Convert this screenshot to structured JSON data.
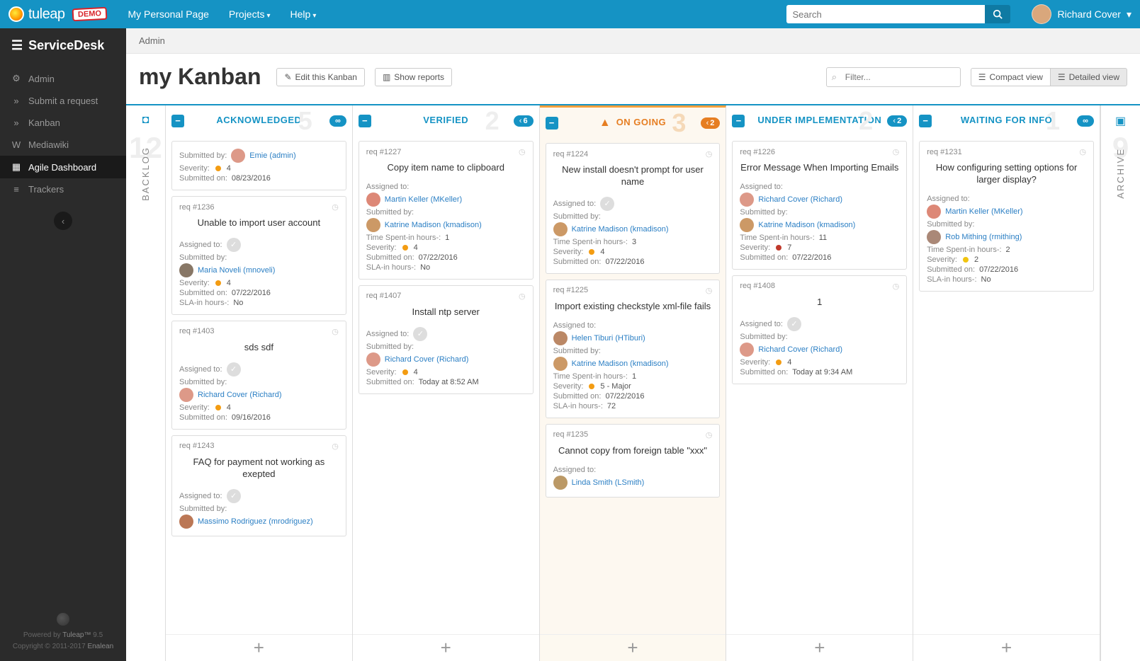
{
  "topbar": {
    "brand": "tuleap",
    "demo": "DEMO",
    "nav": {
      "personal": "My Personal Page",
      "projects": "Projects",
      "help": "Help"
    },
    "search_placeholder": "Search",
    "user_name": "Richard Cover"
  },
  "sidebar": {
    "project": "ServiceDesk",
    "items": [
      {
        "icon": "cogs",
        "label": "Admin"
      },
      {
        "icon": "chevron",
        "label": "Submit a request"
      },
      {
        "icon": "chevron",
        "label": "Kanban"
      },
      {
        "icon": "wiki",
        "label": "Mediawiki"
      },
      {
        "icon": "grid",
        "label": "Agile Dashboard"
      },
      {
        "icon": "list",
        "label": "Trackers"
      }
    ],
    "footer_powered": "Powered by ",
    "footer_brand": "Tuleap™",
    "footer_version": " 9.5",
    "footer_copyright": "Copyright © 2011-2017 ",
    "footer_company": "Enalean"
  },
  "breadcrumb": "Admin",
  "header": {
    "title": "my Kanban",
    "edit_btn": "Edit this Kanban",
    "reports_btn": "Show reports",
    "filter_placeholder": "Filter...",
    "compact": "Compact view",
    "detailed": "Detailed view"
  },
  "rails": {
    "backlog": {
      "label": "BACKLOG",
      "count": "12"
    },
    "archive": {
      "label": "ARCHIVE",
      "count": "9"
    }
  },
  "columns": [
    {
      "title": "ACKNOWLEDGED",
      "count": "5",
      "wip": "inf",
      "highlight": false
    },
    {
      "title": "VERIFIED",
      "count": "2",
      "wip": "6",
      "highlight": false
    },
    {
      "title": "ON GOING",
      "count": "3",
      "wip": "2",
      "highlight": true,
      "warn": true
    },
    {
      "title": "UNDER IMPLEMENTATION",
      "count": "2",
      "wip": "2",
      "highlight": false
    },
    {
      "title": "WAITING FOR INFO",
      "count": "1",
      "wip": "inf",
      "highlight": false
    }
  ],
  "cards": {
    "ack": [
      {
        "id": "",
        "title": "",
        "partial": true,
        "rows": [
          {
            "k": "Submitted by:",
            "avatar": "#d98",
            "link": "Emie (admin)"
          },
          {
            "k": "Severity:",
            "sev": "orange",
            "v": "4"
          },
          {
            "k": "Submitted on:",
            "v": "08/23/2016"
          }
        ]
      },
      {
        "id": "req #1236",
        "title": "Unable to import user account",
        "rows": [
          {
            "k": "Assigned to:",
            "ghost": true
          },
          {
            "k": "Submitted by:"
          },
          {
            "avatar": "#876",
            "link": "Maria Noveli (mnoveli)"
          },
          {
            "k": "Severity:",
            "sev": "orange",
            "v": "4"
          },
          {
            "k": "Submitted on:",
            "v": "07/22/2016"
          },
          {
            "k": "SLA-in hours-:",
            "v": "No"
          }
        ]
      },
      {
        "id": "req #1403",
        "title": "sds sdf",
        "rows": [
          {
            "k": "Assigned to:",
            "ghost": true
          },
          {
            "k": "Submitted by:"
          },
          {
            "avatar": "#d98",
            "link": "Richard Cover (Richard)"
          },
          {
            "k": "Severity:",
            "sev": "orange",
            "v": "4"
          },
          {
            "k": "Submitted on:",
            "v": "09/16/2016"
          }
        ]
      },
      {
        "id": "req #1243",
        "title": "FAQ for payment not working as exepted",
        "rows": [
          {
            "k": "Assigned to:",
            "ghost": true
          },
          {
            "k": "Submitted by:"
          },
          {
            "avatar": "#b75",
            "link": "Massimo Rodriguez (mrodriguez)"
          }
        ]
      }
    ],
    "ver": [
      {
        "id": "req #1227",
        "title": "Copy item name to clipboard",
        "rows": [
          {
            "k": "Assigned to:"
          },
          {
            "avatar": "#d87",
            "link": "Martin Keller (MKeller)"
          },
          {
            "k": "Submitted by:"
          },
          {
            "avatar": "#c96",
            "link": "Katrine Madison (kmadison)"
          },
          {
            "k": "Time Spent-in hours-:",
            "v": "1"
          },
          {
            "k": "Severity:",
            "sev": "orange",
            "v": "4"
          },
          {
            "k": "Submitted on:",
            "v": "07/22/2016"
          },
          {
            "k": "SLA-in hours-:",
            "v": "No"
          }
        ]
      },
      {
        "id": "req #1407",
        "title": "Install ntp server",
        "rows": [
          {
            "k": "Assigned to:",
            "ghost": true
          },
          {
            "k": "Submitted by:"
          },
          {
            "avatar": "#d98",
            "link": "Richard Cover (Richard)"
          },
          {
            "k": "Severity:",
            "sev": "orange",
            "v": "4"
          },
          {
            "k": "Submitted on:",
            "v": "Today at 8:52 AM"
          }
        ]
      }
    ],
    "ong": [
      {
        "id": "req #1224",
        "title": "New install doesn't prompt for user name",
        "rows": [
          {
            "k": "Assigned to:",
            "ghost": true
          },
          {
            "k": "Submitted by:"
          },
          {
            "avatar": "#c96",
            "link": "Katrine Madison (kmadison)"
          },
          {
            "k": "Time Spent-in hours-:",
            "v": "3"
          },
          {
            "k": "Severity:",
            "sev": "orange",
            "v": "4"
          },
          {
            "k": "Submitted on:",
            "v": "07/22/2016"
          }
        ]
      },
      {
        "id": "req #1225",
        "title": "Import existing checkstyle xml-file fails",
        "rows": [
          {
            "k": "Assigned to:"
          },
          {
            "avatar": "#b86",
            "link": "Helen Tiburi (HTiburi)"
          },
          {
            "k": "Submitted by:"
          },
          {
            "avatar": "#c96",
            "link": "Katrine Madison (kmadison)"
          },
          {
            "k": "Time Spent-in hours-:",
            "v": "1"
          },
          {
            "k": "Severity:",
            "sev": "orange",
            "v": "5 - Major"
          },
          {
            "k": "Submitted on:",
            "v": "07/22/2016"
          },
          {
            "k": "SLA-in hours-:",
            "v": "72"
          }
        ]
      },
      {
        "id": "req #1235",
        "title": "Cannot copy from foreign table \"xxx\"",
        "rows": [
          {
            "k": "Assigned to:"
          },
          {
            "avatar": "#b96",
            "link": "Linda Smith (LSmith)"
          }
        ]
      }
    ],
    "imp": [
      {
        "id": "req #1226",
        "title": "Error Message When Importing Emails",
        "rows": [
          {
            "k": "Assigned to:"
          },
          {
            "avatar": "#d98",
            "link": "Richard Cover (Richard)"
          },
          {
            "k": "Submitted by:"
          },
          {
            "avatar": "#c96",
            "link": "Katrine Madison (kmadison)"
          },
          {
            "k": "Time Spent-in hours-:",
            "v": "11"
          },
          {
            "k": "Severity:",
            "sev": "red",
            "v": "7"
          },
          {
            "k": "Submitted on:",
            "v": "07/22/2016"
          }
        ]
      },
      {
        "id": "req #1408",
        "title": "1",
        "rows": [
          {
            "k": "Assigned to:",
            "ghost": true
          },
          {
            "k": "Submitted by:"
          },
          {
            "avatar": "#d98",
            "link": "Richard Cover (Richard)"
          },
          {
            "k": "Severity:",
            "sev": "orange",
            "v": "4"
          },
          {
            "k": "Submitted on:",
            "v": "Today at 9:34 AM"
          }
        ]
      }
    ],
    "wfi": [
      {
        "id": "req #1231",
        "title": "How configuring setting options for larger display?",
        "rows": [
          {
            "k": "Assigned to:"
          },
          {
            "avatar": "#d87",
            "link": "Martin Keller (MKeller)"
          },
          {
            "k": "Submitted by:"
          },
          {
            "avatar": "#a87",
            "link": "Rob Mithing (rmithing)"
          },
          {
            "k": "Time Spent-in hours-:",
            "v": "2"
          },
          {
            "k": "Severity:",
            "sev": "yellow",
            "v": "2"
          },
          {
            "k": "Submitted on:",
            "v": "07/22/2016"
          },
          {
            "k": "SLA-in hours-:",
            "v": "No"
          }
        ]
      }
    ]
  }
}
